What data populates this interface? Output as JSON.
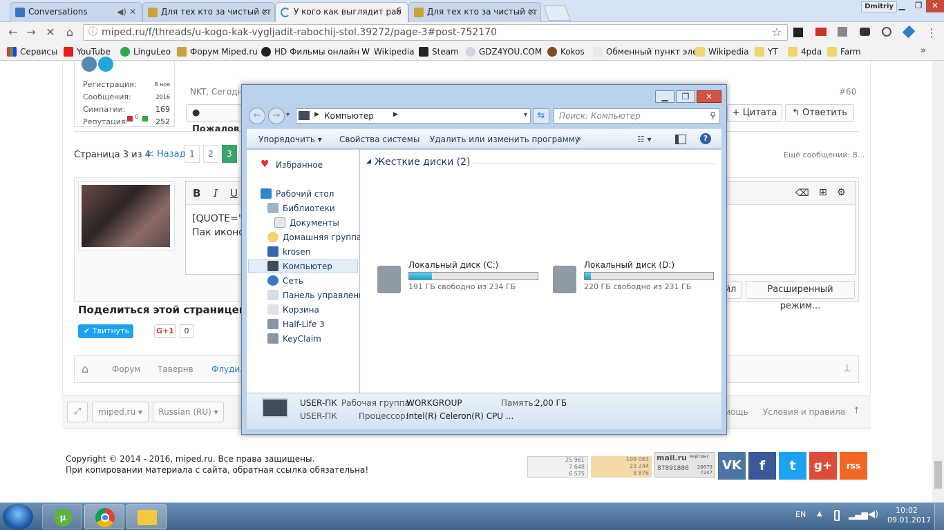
{
  "tabs": [
    {
      "title": "Conversations",
      "active": false
    },
    {
      "title": "Для тех кто за чистый ст",
      "active": false
    },
    {
      "title": "У кого как выглядит раб",
      "active": true
    },
    {
      "title": "Для тех кто за чистый ст",
      "active": false
    }
  ],
  "window_user": "Dmitriy",
  "address": {
    "url": "miped.ru/f/threads/u-kogo-kak-vygljadit-rabochij-stol.39272/page-3#post-752170"
  },
  "bookmarks": [
    "Сервисы",
    "YouTube",
    "LinguLeo",
    "Форум Miped.ru",
    "HD Фильмы онлайн",
    "Wikipedia",
    "Steam",
    "GDZ4YOU.COM",
    "Kokos",
    "Обменный пункт эле",
    "Wikipedia",
    "YT",
    "4pda",
    "Farm"
  ],
  "profile": {
    "labels": [
      "Регистрация:",
      "Сообщения:",
      "Симпатии:",
      "Репутация:"
    ],
    "values": [
      "8 ноя 2016",
      "169",
      "252"
    ],
    "rep_neg": "0"
  },
  "post": {
    "author_preview": "NKT, Сегодн",
    "number": "#60",
    "report_label": "Пожалов",
    "quote_label": "+ Цитата",
    "reply_label": "Ответить"
  },
  "pagination": {
    "label": "Страница 3 из 4",
    "prev": "< Назад",
    "pages": [
      "1",
      "2",
      "3"
    ],
    "more": "Ещё сообщений: 8..."
  },
  "editor": {
    "bold": "B",
    "italic": "I",
    "underline": "U",
    "text_line1": "[QUOTE=\"",
    "text_line2": "Пак иконок",
    "btn_partial": "йл",
    "btn_advanced": "Расширенный режим..."
  },
  "share": {
    "title": "Поделиться этой страницей",
    "tweet": "Твитнуть",
    "gplus": "G+1",
    "gplus_count": "0"
  },
  "breadcrumb": [
    "Форум",
    "Тавернв",
    "Флудил"
  ],
  "footer_bar": {
    "style": "miped.ru",
    "lang": "Russian (RU)",
    "help": "мощь",
    "terms": "Условия и правила"
  },
  "copyright": {
    "line1": "Copyright © 2014 - 2016, miped.ru. Все права защищены.",
    "line2": "При копировании материала с сайта, обратная ссылка обязательна!"
  },
  "counters": {
    "c1": [
      "25 961",
      "7 648",
      "6 575"
    ],
    "c2": [
      "109 063",
      "23 244",
      "8 876"
    ],
    "mail_title": "mail.ru",
    "mail_sub": "РЕЙТИНГ",
    "mail_num": "87891886",
    "mail_side": [
      "28679",
      "7247"
    ]
  },
  "social": [
    "VK",
    "f",
    "t",
    "g+",
    "rss"
  ],
  "explorer": {
    "breadcrumb": "Компьютер",
    "search_placeholder": "Поиск: Компьютер",
    "toolbar": [
      "Упорядочить",
      "Свойства системы",
      "Удалить или изменить программу",
      "»"
    ],
    "sidebar": [
      "Избранное",
      "Рабочий стол",
      "Библиотеки",
      "Документы",
      "Домашняя группа",
      "krosen",
      "Компьютер",
      "Сеть",
      "Панель управления",
      "Корзина",
      "Half-Life 3",
      "KeyClaim"
    ],
    "group_title": "Жесткие диски (2)",
    "drives": [
      {
        "name": "Локальный диск (C:)",
        "free": "191 ГБ свободно из 234 ГБ",
        "used_fraction": 0.18
      },
      {
        "name": "Локальный диск (D:)",
        "free": "220 ГБ свободно из 231 ГБ",
        "used_fraction": 0.05
      }
    ],
    "details": {
      "pc": "USER-ПК",
      "workgroup_label": "Рабочая группа:",
      "workgroup": "WORKGROUP",
      "memory_label": "Память:",
      "memory": "2,00 ГБ",
      "pc2": "USER-ПК",
      "cpu_label": "Процессор:",
      "cpu": "Intel(R) Celeron(R) CPU ..."
    }
  },
  "tray": {
    "lang": "EN",
    "time": "10:02",
    "date": "09.01.2017"
  },
  "colors": {
    "accent": "#2b7fc7",
    "green_active": "#3aa36b",
    "explorer_frame": "#b9d1ea"
  }
}
